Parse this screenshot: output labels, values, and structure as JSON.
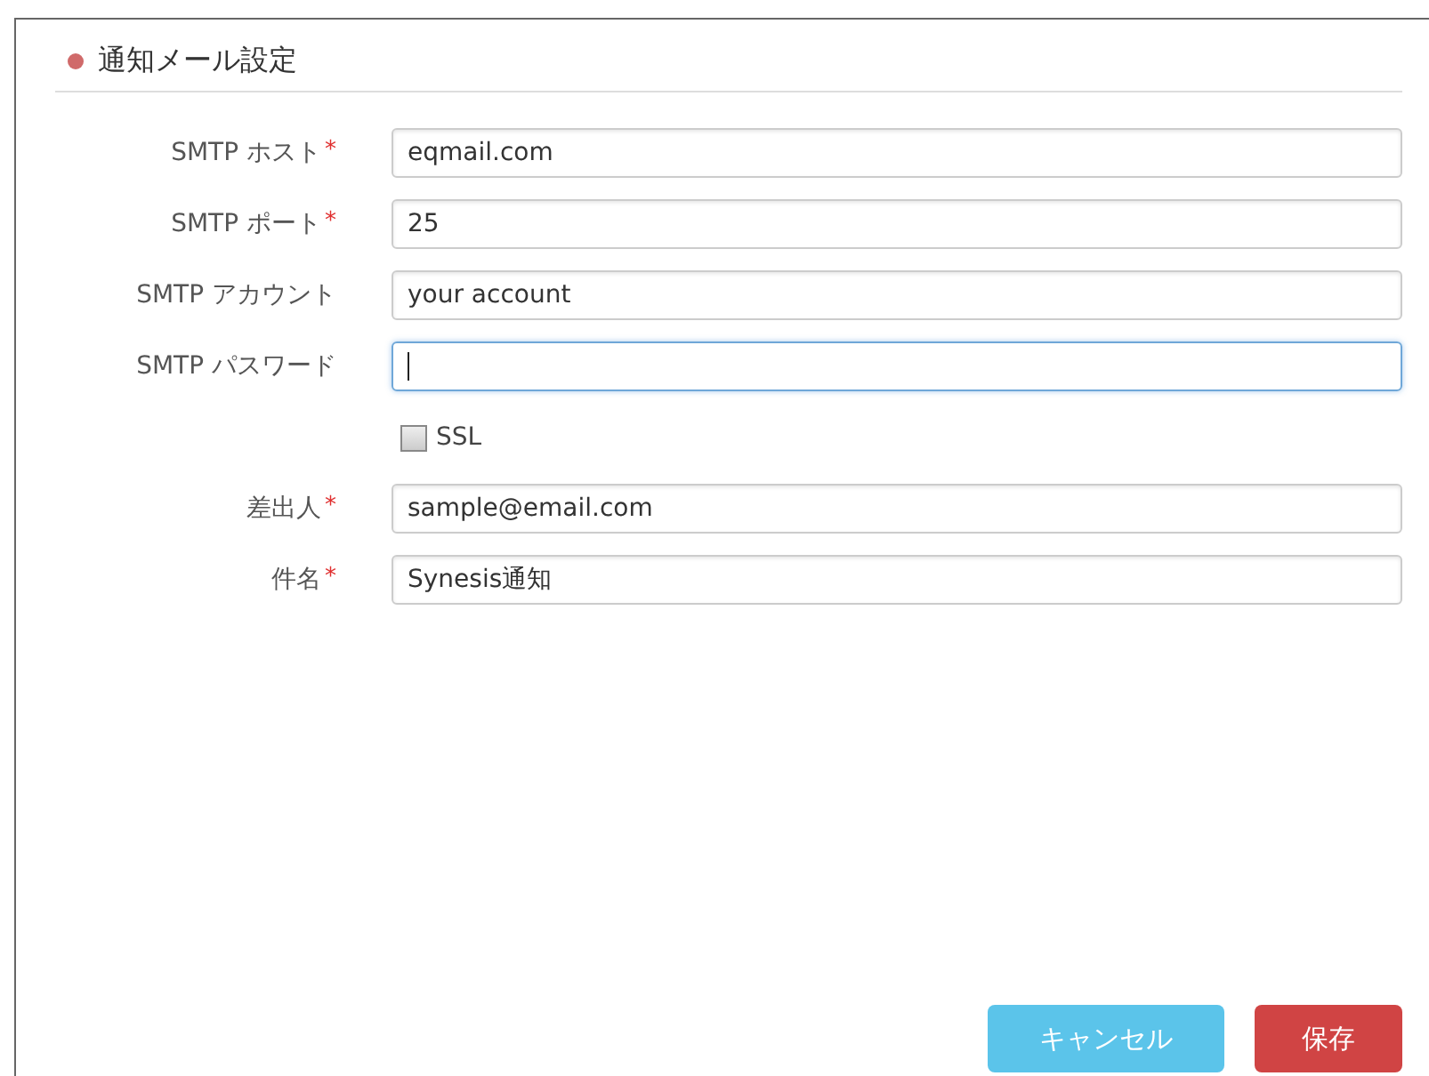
{
  "section": {
    "title": "通知メール設定"
  },
  "fields": [
    {
      "kind": "text",
      "label": "SMTP ホスト",
      "required_mark": "*",
      "value": "eqmail.com",
      "focused": false
    },
    {
      "kind": "text",
      "label": "SMTP ポート",
      "required_mark": "*",
      "value": "25",
      "focused": false
    },
    {
      "kind": "text",
      "label": "SMTP アカウント",
      "value": "your account",
      "focused": false
    },
    {
      "kind": "text",
      "label": "SMTP パスワード",
      "focused": true
    },
    {
      "kind": "checkbox",
      "label": "SSL",
      "checked": false
    },
    {
      "kind": "text",
      "label": "差出人",
      "required_mark": "*",
      "value": "sample@email.com",
      "focused": false
    },
    {
      "kind": "text",
      "label": "件名",
      "required_mark": "*",
      "value": "Synesis通知",
      "focused": false
    }
  ],
  "buttons": [
    {
      "label": "キャンセル",
      "kind": "secondary"
    },
    {
      "label": "保存",
      "kind": "primary"
    }
  ]
}
